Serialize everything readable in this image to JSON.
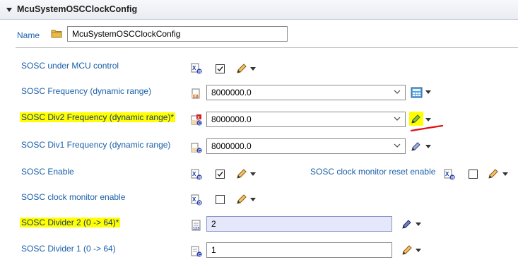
{
  "header": {
    "title": "McuSystemOSCClockConfig"
  },
  "name_row": {
    "label": "Name",
    "value": "McuSystemOSCClockConfig"
  },
  "rows": [
    {
      "label": "SOSC under MCU control",
      "checked": true
    },
    {
      "label": "SOSC Frequency (dynamic range)",
      "value": "8000000.0"
    },
    {
      "label": "SOSC Div2 Frequency (dynamic range)*",
      "value": "8000000.0",
      "highlighted": true
    },
    {
      "label": "SOSC Div1 Frequency (dynamic range)",
      "value": "8000000.0"
    },
    {
      "label": "SOSC Enable",
      "checked": true
    },
    {
      "label": "SOSC clock monitor reset enable",
      "checked": false
    },
    {
      "label": "SOSC clock monitor enable",
      "checked": false
    },
    {
      "label": "SOSC Divider 2 (0 -> 64)*",
      "value": "2",
      "highlighted": true
    },
    {
      "label": "SOSC Divider 1 (0 -> 64)",
      "value": "1"
    }
  ],
  "colors": {
    "label_blue": "#1a5fa8",
    "highlight": "#ffff00",
    "active_field": "#e5e8fb",
    "annotation_red": "#e01010"
  },
  "icons": [
    "chevron-down-icon",
    "folder-icon",
    "boolean-type-icon",
    "float-type-icon",
    "integer-type-icon",
    "pencil-icon",
    "calculator-icon",
    "wand-icon"
  ]
}
